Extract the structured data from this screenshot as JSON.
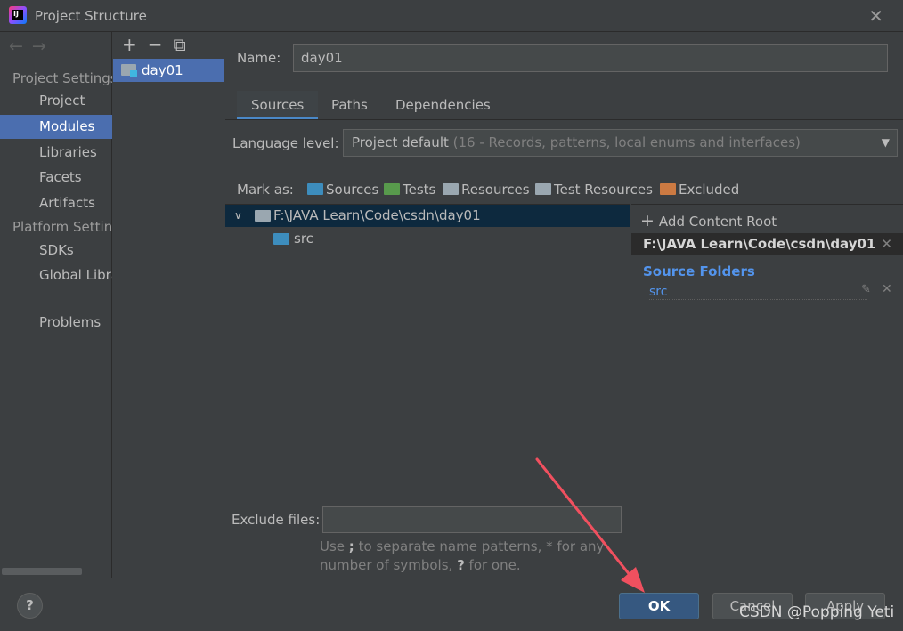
{
  "window": {
    "title": "Project Structure",
    "app_icon_text": "IJ"
  },
  "left_nav": {
    "section_project_settings": "Project Settings",
    "project_items": [
      "Project",
      "Modules",
      "Libraries",
      "Facets",
      "Artifacts"
    ],
    "selected": "Modules",
    "section_platform_settings": "Platform Settings",
    "platform_items": [
      "SDKs",
      "Global Libraries"
    ],
    "problems": "Problems"
  },
  "modules": {
    "toolbar": [
      "+",
      "−",
      "⧉"
    ],
    "items": [
      "day01"
    ]
  },
  "module_detail": {
    "name_label": "Name:",
    "name_value": "day01",
    "tabs": [
      "Sources",
      "Paths",
      "Dependencies"
    ],
    "active_tab": "Sources",
    "language_level_label": "Language level:",
    "language_level_value": "Project default",
    "language_level_hint": "(16 - Records, patterns, local enums and interfaces)",
    "mark_as_label": "Mark as:",
    "mark_as_options": [
      {
        "label": "Sources",
        "color": "#3d8dbd"
      },
      {
        "label": "Tests",
        "color": "#589a4c"
      },
      {
        "label": "Resources",
        "color": "#9aa7b0"
      },
      {
        "label": "Test Resources",
        "color": "#9aa7b0"
      },
      {
        "label": "Excluded",
        "color": "#cc7a42"
      }
    ],
    "tree_root": "F:\\JAVA Learn\\Code\\csdn\\day01",
    "tree_child": "src",
    "exclude_label": "Exclude files:",
    "exclude_value": "",
    "exclude_hint_1": "Use ",
    "exclude_hint_semicolon": ";",
    "exclude_hint_2": " to separate name patterns, * for any number of symbols, ",
    "exclude_hint_q": "?",
    "exclude_hint_3": " for one."
  },
  "content_root_panel": {
    "add_label": "Add Content Root",
    "root_path": "F:\\JAVA Learn\\Code\\csdn\\day01",
    "source_folders_label": "Source Folders",
    "source_folders": [
      "src"
    ]
  },
  "footer": {
    "help": "?",
    "ok": "OK",
    "cancel": "Cancel",
    "apply": "Apply"
  },
  "watermark": "CSDN @Popping Yeti",
  "colors": {
    "background": "#3c3f41",
    "selection": "#4b6eaf",
    "accent_blue": "#5394ec",
    "annotation_arrow": "#f0505f"
  }
}
